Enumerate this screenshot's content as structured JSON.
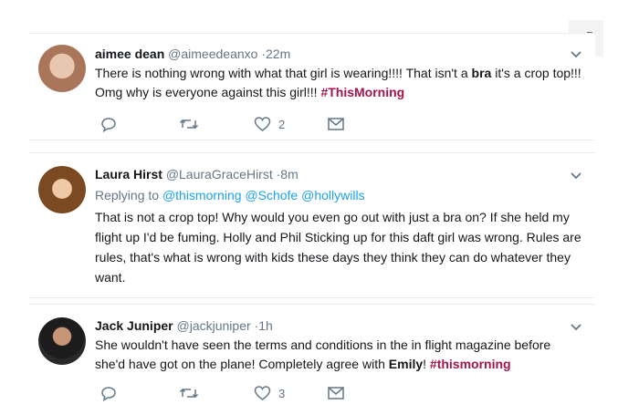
{
  "tweets": [
    {
      "name": "aimee dean",
      "handle": "@aimeedeanxo",
      "time": "·22m",
      "text_parts": [
        "There is nothing wrong with what that girl is wearing!!!! That isn't a ",
        "bra",
        " it's a crop top!!! Omg why is everyone against this girl!!! ",
        "#ThisMorning"
      ],
      "likes": "2"
    },
    {
      "name": "Laura Hirst",
      "handle": "@LauraGraceHirst",
      "time": "·8m",
      "replying_prefix": "Replying to",
      "mentions": [
        "@thismorning",
        "@Schofe",
        "@hollywills"
      ],
      "text": "That is not a crop top! Why would you even go out with just a bra on? If she held my flight up I'd be fuming. Holly and Phil Sticking up for this daft girl was wrong. Rules are rules, that's what is wrong with kids these days they think they can do whatever they want."
    },
    {
      "name": "Jack Juniper",
      "handle": "@jackjuniper",
      "time": "·1h",
      "text_parts": [
        "She wouldn't have seen the terms and conditions in the in flight magazine before she'd have got on the plane! Completely agree with ",
        "Emily",
        "! ",
        "#thismorning"
      ],
      "likes": "3"
    }
  ],
  "colors": {
    "hashtag": "#a3144a",
    "mention": "#1da1f2",
    "muted": "#657786"
  },
  "icons": [
    "reply-icon",
    "retweet-icon",
    "like-icon",
    "message-icon",
    "expand-icon",
    "chevron-down-icon"
  ]
}
